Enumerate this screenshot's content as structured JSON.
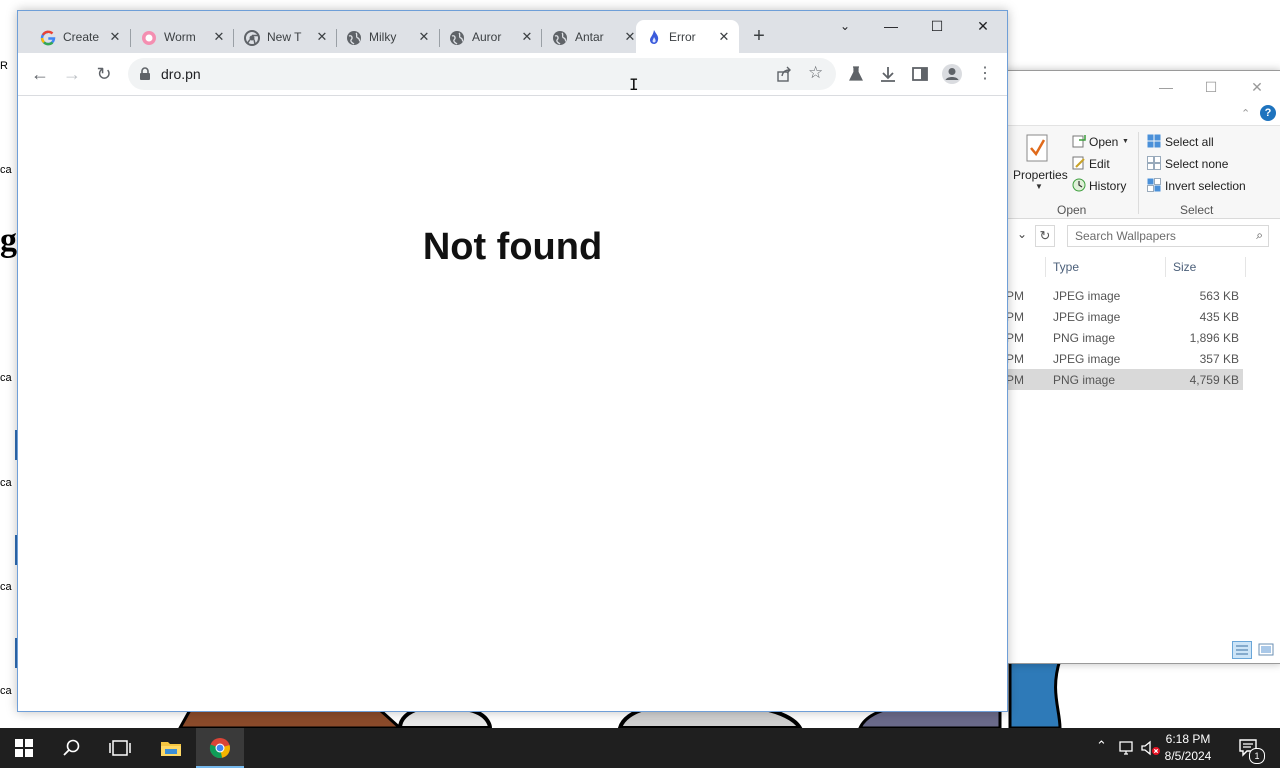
{
  "desktop": {
    "partial_labels": [
      "R",
      "ca",
      "ca",
      "ca",
      "ca",
      "ca"
    ],
    "big_glyph": "g"
  },
  "browser": {
    "tabs": [
      {
        "title": "Create",
        "icon": "google-icon"
      },
      {
        "title": "Worm",
        "icon": "pink-flower-icon"
      },
      {
        "title": "New T",
        "icon": "chrome-icon"
      },
      {
        "title": "Milky",
        "icon": "globe-icon"
      },
      {
        "title": "Auror",
        "icon": "globe-icon"
      },
      {
        "title": "Antar",
        "icon": "globe-icon"
      },
      {
        "title": "Error",
        "icon": "flame-icon"
      }
    ],
    "close_glyph": "✕",
    "new_tab_glyph": "+",
    "address": "dro.pn",
    "page_heading": "Not found",
    "active_tab_index": 6
  },
  "explorer": {
    "ribbon": {
      "properties_label": "Properties",
      "open_label": "Open",
      "edit_label": "Edit",
      "history_label": "History",
      "select_all_label": "Select all",
      "select_none_label": "Select none",
      "invert_selection_label": "Invert selection",
      "group_open": "Open",
      "group_select": "Select"
    },
    "search_placeholder": "Search Wallpapers",
    "columns": {
      "type": "Type",
      "size": "Size"
    },
    "files": [
      {
        "time_suffix": "PM",
        "type": "JPEG image",
        "size": "563 KB",
        "selected": false
      },
      {
        "time_suffix": "PM",
        "type": "JPEG image",
        "size": "435 KB",
        "selected": false
      },
      {
        "time_suffix": "PM",
        "type": "PNG image",
        "size": "1,896 KB",
        "selected": false
      },
      {
        "time_suffix": "PM",
        "type": "JPEG image",
        "size": "357 KB",
        "selected": false
      },
      {
        "time_suffix": "PM",
        "type": "PNG image",
        "size": "4,759 KB",
        "selected": true
      }
    ]
  },
  "taskbar": {
    "time": "6:18 PM",
    "date": "8/5/2024",
    "notification_count": "1",
    "accent": "#76b9ed"
  }
}
